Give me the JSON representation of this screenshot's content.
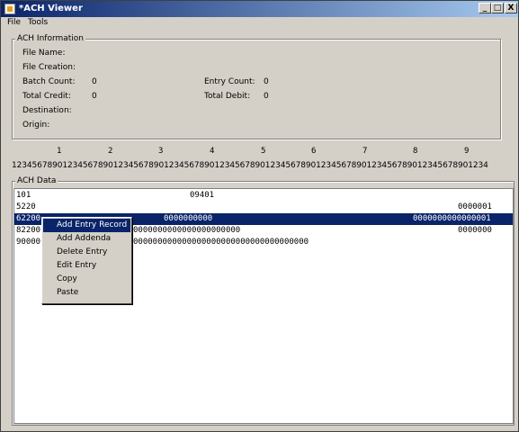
{
  "window": {
    "title": "*ACH Viewer",
    "minimize": "_",
    "maximize": "□",
    "close": "X"
  },
  "menubar": [
    "File",
    "Tools"
  ],
  "ach_info": {
    "legend": "ACH Information",
    "file_name_label": "File Name:",
    "file_creation_label": "File Creation:",
    "batch_count_label": "Batch Count:",
    "batch_count_value": "0",
    "entry_count_label": "Entry Count:",
    "entry_count_value": "0",
    "total_credit_label": "Total Credit:",
    "total_credit_value": "0",
    "total_debit_label": "Total Debit:",
    "total_debit_value": "0",
    "destination_label": "Destination:",
    "origin_label": "Origin:"
  },
  "ruler": {
    "tens": [
      "1",
      "2",
      "3",
      "4",
      "5",
      "6",
      "7",
      "8",
      "9"
    ],
    "digits": "1234567890123456789012345678901234567890123456789012345678901234567890123456789012345678901234"
  },
  "ach_data": {
    "legend": "ACH Data",
    "rows": [
      {
        "a": "101",
        "b": "09401",
        "c": ""
      },
      {
        "a": "5220",
        "b": "",
        "c": "0000001"
      },
      {
        "a": "62200",
        "b": "0000000000",
        "c": "0000000000000001"
      },
      {
        "a": "82200",
        "b": "0000000000000000000000",
        "c": "0000000"
      },
      {
        "a": "90000",
        "b": "000000000000000000000000000000000000",
        "c": ""
      }
    ]
  },
  "context_menu": [
    "Add Entry Record",
    "Add Addenda",
    "Delete Entry",
    "Edit Entry",
    "Copy",
    "Paste"
  ]
}
